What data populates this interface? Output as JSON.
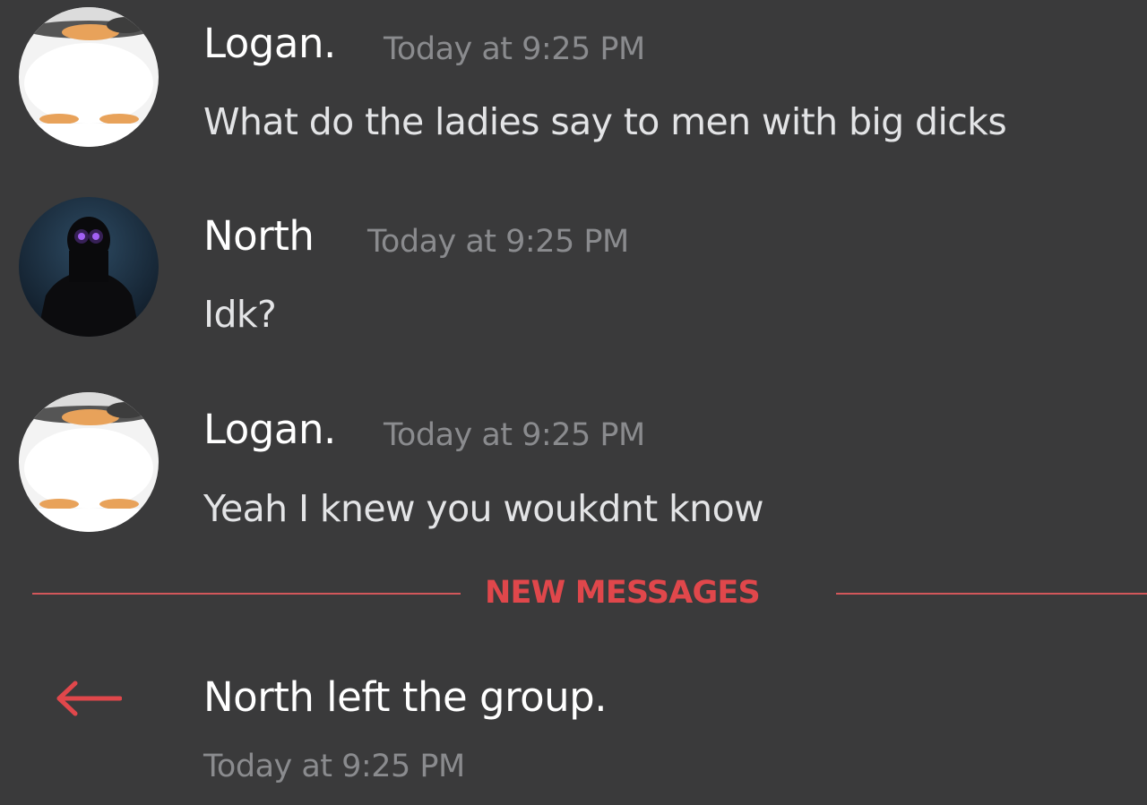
{
  "messages": [
    {
      "author": "Logan.",
      "timestamp": "Today at 9:25 PM",
      "content": "What do the ladies say to men with big dicks",
      "avatar": "penguin-avatar"
    },
    {
      "author": "North",
      "timestamp": "Today at 9:25 PM",
      "content": "Idk?",
      "avatar": "dark-figure-avatar"
    },
    {
      "author": "Logan.",
      "timestamp": "Today at 9:25 PM",
      "content": "Yeah I knew you woukdnt know",
      "avatar": "penguin-avatar"
    }
  ],
  "divider": {
    "label": "NEW MESSAGES"
  },
  "system_message": {
    "icon": "left-arrow-icon",
    "text": "North left the group.",
    "timestamp": "Today at 9:25 PM"
  },
  "colors": {
    "background": "#3a3a3b",
    "accent_red": "#e0474b",
    "timestamp_gray": "#8a8b8e"
  }
}
